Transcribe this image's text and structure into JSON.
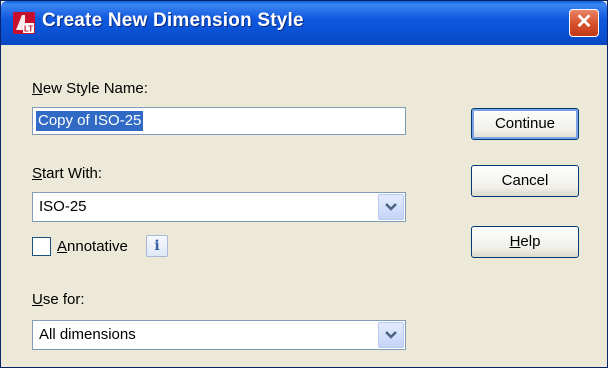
{
  "window": {
    "title": "Create New Dimension Style",
    "close_symbol": "✕",
    "icon": "autocad-lt-icon"
  },
  "style_name": {
    "label_mnemonic": "N",
    "label_rest": "ew Style Name:",
    "value": "Copy of ISO-25"
  },
  "start_with": {
    "label_mnemonic": "S",
    "label_rest": "tart With:",
    "value": "ISO-25"
  },
  "annotative": {
    "label_mnemonic": "A",
    "label_rest": "nnotative",
    "checked": false,
    "info_glyph": "i"
  },
  "use_for": {
    "label_mnemonic": "U",
    "label_rest": "se for:",
    "value": "All dimensions"
  },
  "buttons": {
    "continue": "Continue",
    "cancel": "Cancel",
    "help_mnemonic": "H",
    "help_rest": "elp"
  },
  "colors": {
    "titlebar": "#0a52d4",
    "close": "#d9522e",
    "dialog_bg": "#ece9d8",
    "selection": "#316ac5"
  }
}
